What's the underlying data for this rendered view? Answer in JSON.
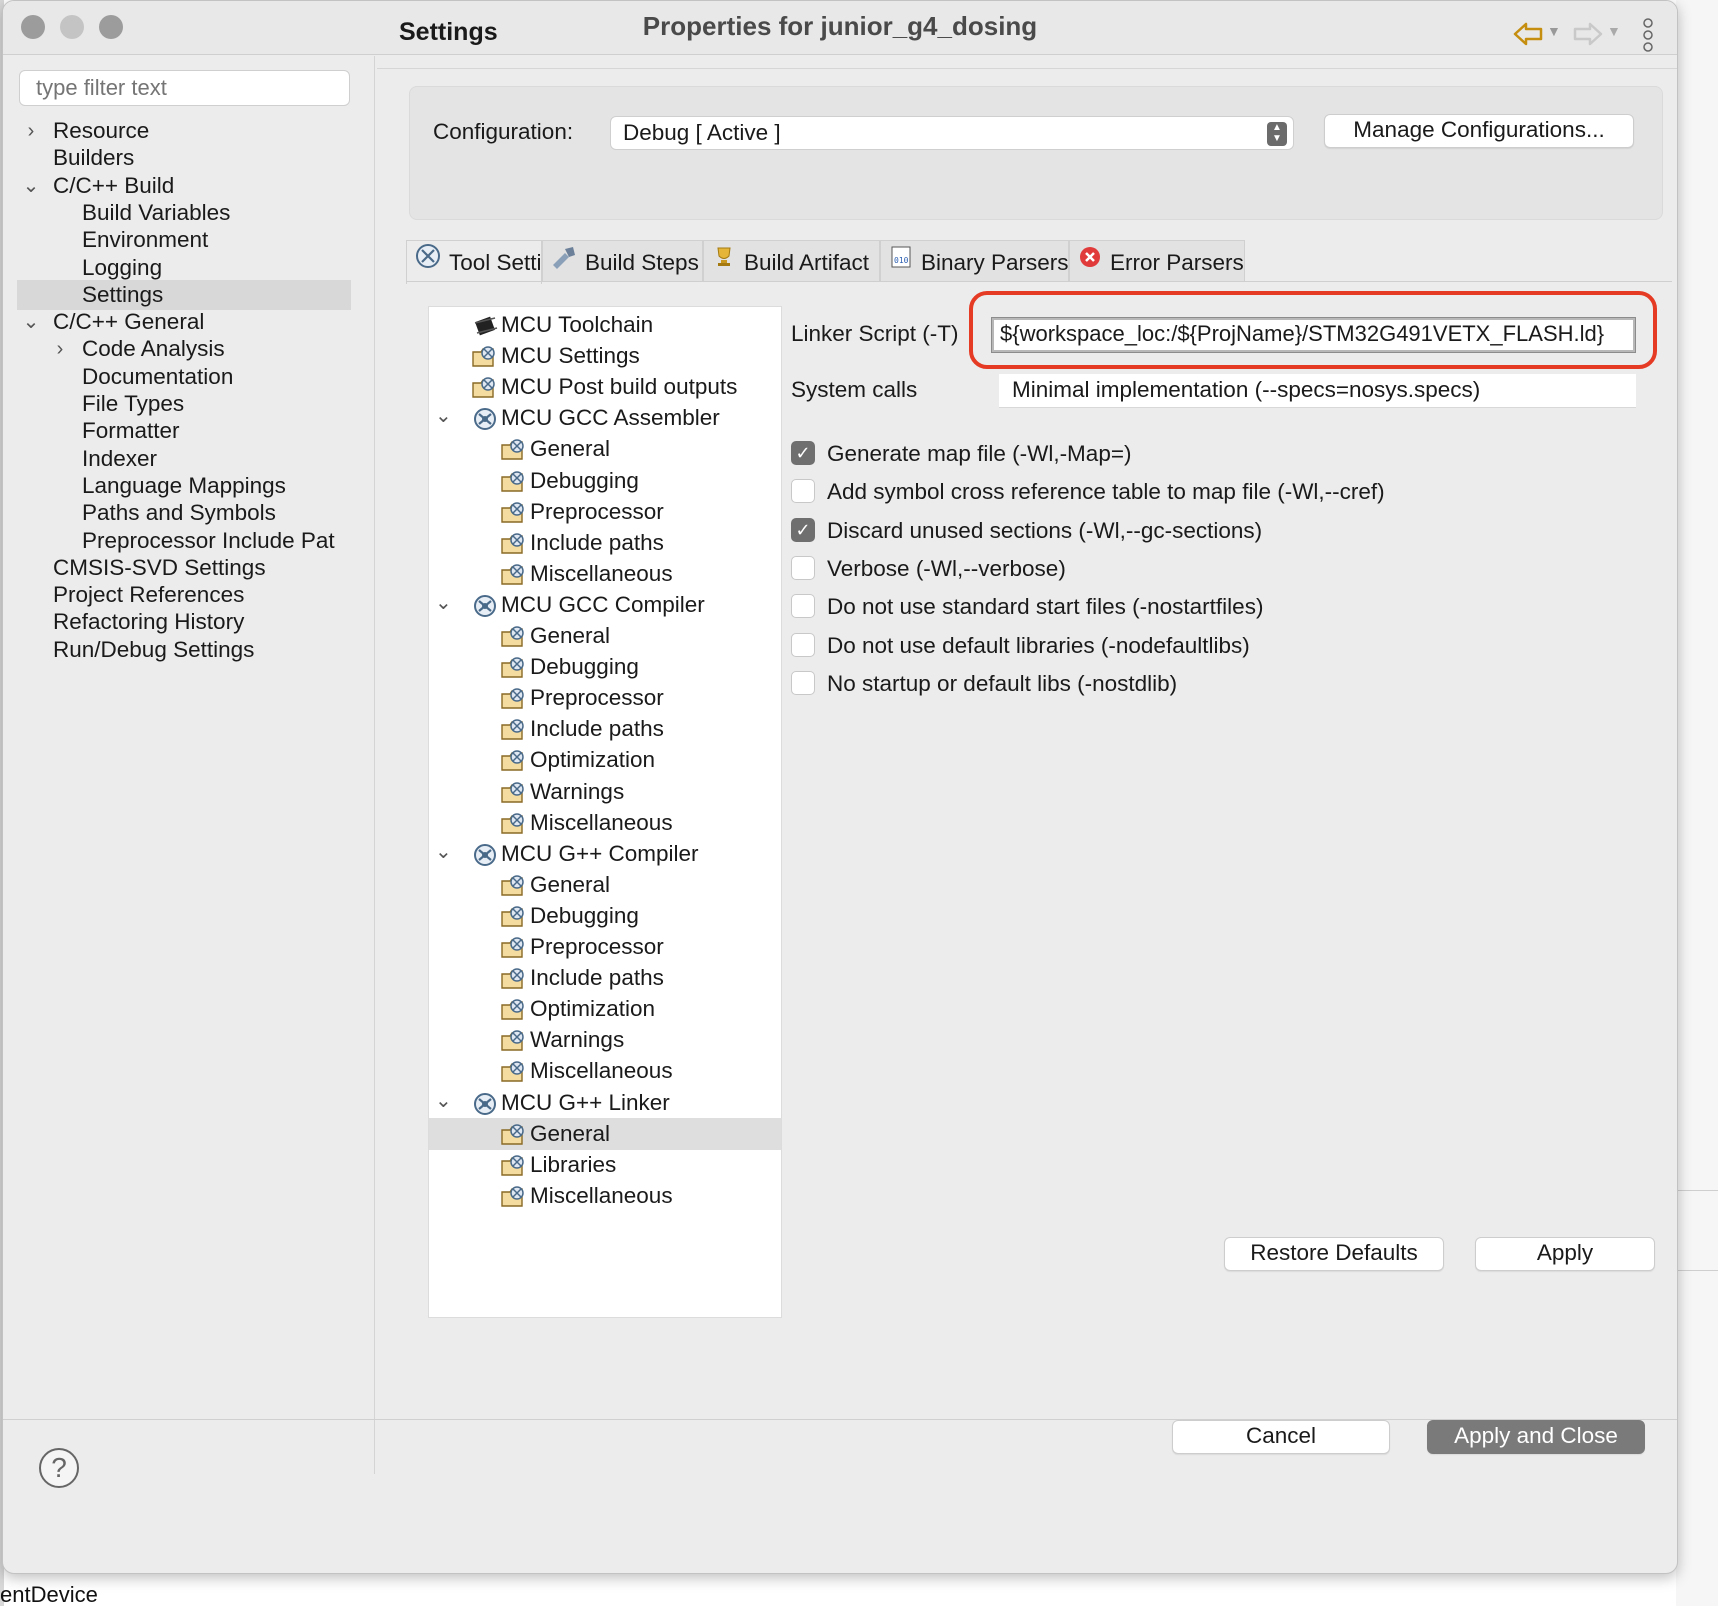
{
  "window": {
    "title": "Properties for junior_g4_dosing"
  },
  "background": {
    "partial_text": "entDevice"
  },
  "left": {
    "filter_placeholder": "type filter text",
    "tree": [
      {
        "label": "Resource",
        "chevron": "›"
      },
      {
        "label": "Builders"
      },
      {
        "label": "C/C++ Build",
        "chevron": "⌄"
      },
      {
        "label": "Build Variables"
      },
      {
        "label": "Environment"
      },
      {
        "label": "Logging"
      },
      {
        "label": "Settings"
      },
      {
        "label": "C/C++ General",
        "chevron": "⌄"
      },
      {
        "label": "Code Analysis",
        "chevron": "›"
      },
      {
        "label": "Documentation"
      },
      {
        "label": "File Types"
      },
      {
        "label": "Formatter"
      },
      {
        "label": "Indexer"
      },
      {
        "label": "Language Mappings"
      },
      {
        "label": "Paths and Symbols"
      },
      {
        "label": "Preprocessor Include Pat"
      },
      {
        "label": "CMSIS-SVD Settings"
      },
      {
        "label": "Project References"
      },
      {
        "label": "Refactoring History"
      },
      {
        "label": "Run/Debug Settings"
      }
    ]
  },
  "page": {
    "title": "Settings",
    "nav_back_icon": "back-arrow-icon",
    "nav_forward_icon": "forward-arrow-icon",
    "accent": "#c58e0f"
  },
  "config": {
    "label": "Configuration:",
    "value": "Debug  [ Active ]",
    "manage_label": "Manage Configurations..."
  },
  "tabs": [
    {
      "label": "Tool Settings",
      "icon": "tool-settings-icon"
    },
    {
      "label": "Build Steps",
      "icon": "build-steps-icon"
    },
    {
      "label": "Build Artifact",
      "icon": "trophy-icon"
    },
    {
      "label": "Binary Parsers",
      "icon": "binary-icon"
    },
    {
      "label": "Error Parsers",
      "icon": "error-icon"
    }
  ],
  "tool_tree": [
    {
      "label": "MCU Toolchain",
      "icon": "chip-icon"
    },
    {
      "label": "MCU Settings",
      "icon": "settings-folder-icon"
    },
    {
      "label": "MCU Post build outputs",
      "icon": "settings-folder-icon"
    },
    {
      "label": "MCU GCC Assembler",
      "icon": "tool-icon",
      "chevron": "⌄"
    },
    {
      "label": "General",
      "icon": "settings-folder-icon"
    },
    {
      "label": "Debugging",
      "icon": "settings-folder-icon"
    },
    {
      "label": "Preprocessor",
      "icon": "settings-folder-icon"
    },
    {
      "label": "Include paths",
      "icon": "settings-folder-icon"
    },
    {
      "label": "Miscellaneous",
      "icon": "settings-folder-icon"
    },
    {
      "label": "MCU GCC Compiler",
      "icon": "tool-icon",
      "chevron": "⌄"
    },
    {
      "label": "General",
      "icon": "settings-folder-icon"
    },
    {
      "label": "Debugging",
      "icon": "settings-folder-icon"
    },
    {
      "label": "Preprocessor",
      "icon": "settings-folder-icon"
    },
    {
      "label": "Include paths",
      "icon": "settings-folder-icon"
    },
    {
      "label": "Optimization",
      "icon": "settings-folder-icon"
    },
    {
      "label": "Warnings",
      "icon": "settings-folder-icon"
    },
    {
      "label": "Miscellaneous",
      "icon": "settings-folder-icon"
    },
    {
      "label": "MCU G++ Compiler",
      "icon": "tool-icon",
      "chevron": "⌄"
    },
    {
      "label": "General",
      "icon": "settings-folder-icon"
    },
    {
      "label": "Debugging",
      "icon": "settings-folder-icon"
    },
    {
      "label": "Preprocessor",
      "icon": "settings-folder-icon"
    },
    {
      "label": "Include paths",
      "icon": "settings-folder-icon"
    },
    {
      "label": "Optimization",
      "icon": "settings-folder-icon"
    },
    {
      "label": "Warnings",
      "icon": "settings-folder-icon"
    },
    {
      "label": "Miscellaneous",
      "icon": "settings-folder-icon"
    },
    {
      "label": "MCU G++ Linker",
      "icon": "tool-icon",
      "chevron": "⌄"
    },
    {
      "label": "General",
      "icon": "settings-folder-icon"
    },
    {
      "label": "Libraries",
      "icon": "settings-folder-icon"
    },
    {
      "label": "Miscellaneous",
      "icon": "settings-folder-icon"
    }
  ],
  "linker": {
    "script_label": "Linker Script (-T)",
    "script_value": "${workspace_loc:/${ProjName}/STM32G491VETX_FLASH.ld}",
    "highlight_color": "#e53a24",
    "syscalls_label": "System calls",
    "syscalls_value": "Minimal implementation (--specs=nosys.specs)",
    "options": [
      {
        "label": "Generate map file (-Wl,-Map=)",
        "checked": true
      },
      {
        "label": "Add symbol cross reference table to map file (-Wl,--cref)",
        "checked": false
      },
      {
        "label": "Discard unused sections (-Wl,--gc-sections)",
        "checked": true
      },
      {
        "label": "Verbose (-Wl,--verbose)",
        "checked": false
      },
      {
        "label": "Do not use standard start files (-nostartfiles)",
        "checked": false
      },
      {
        "label": "Do not use default libraries (-nodefaultlibs)",
        "checked": false
      },
      {
        "label": "No startup or default libs (-nostdlib)",
        "checked": false
      }
    ]
  },
  "buttons": {
    "restore": "Restore Defaults",
    "apply": "Apply",
    "cancel": "Cancel",
    "apply_close": "Apply and Close",
    "help": "?"
  }
}
